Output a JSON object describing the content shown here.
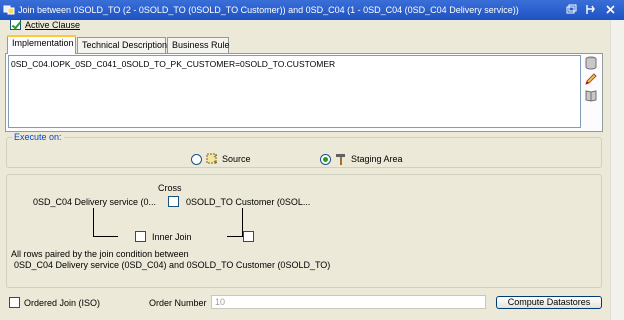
{
  "window": {
    "title": "Join between 0SOLD_TO (2 - 0SOLD_TO (0SOLD_TO Customer)) and 0SD_C04 (1 - 0SD_C04 (0SD_C04 Delivery service))"
  },
  "active_clause": {
    "label": "Active Clause",
    "checked": true
  },
  "tabs": [
    {
      "label": "Implementation",
      "active": true
    },
    {
      "label": "Technical Description",
      "active": false
    },
    {
      "label": "Business Rule",
      "active": false
    }
  ],
  "implementation": {
    "expression": "0SD_C04.IOPK_0SD_C041_0SOLD_TO_PK_CUSTOMER=0SOLD_TO.CUSTOMER"
  },
  "execute_on": {
    "legend": "Execute on:",
    "options": [
      {
        "label": "Source",
        "selected": false
      },
      {
        "label": "Staging Area",
        "selected": true
      }
    ]
  },
  "join": {
    "cross_label": "Cross",
    "left_datastore": "0SD_C04 Delivery service (0...",
    "right_datastore": "0SOLD_TO Customer (0SOL...",
    "inner_join_label": "Inner Join",
    "description_line1": "All rows paired by the join condition between",
    "description_line2": "0SD_C04 Delivery service (0SD_C04) and 0SOLD_TO Customer (0SOLD_TO)"
  },
  "footer": {
    "ordered_join_label": "Ordered Join (ISO)",
    "order_number_label": "Order Number",
    "order_number_value": "10",
    "compute_button": "Compute Datastores"
  }
}
